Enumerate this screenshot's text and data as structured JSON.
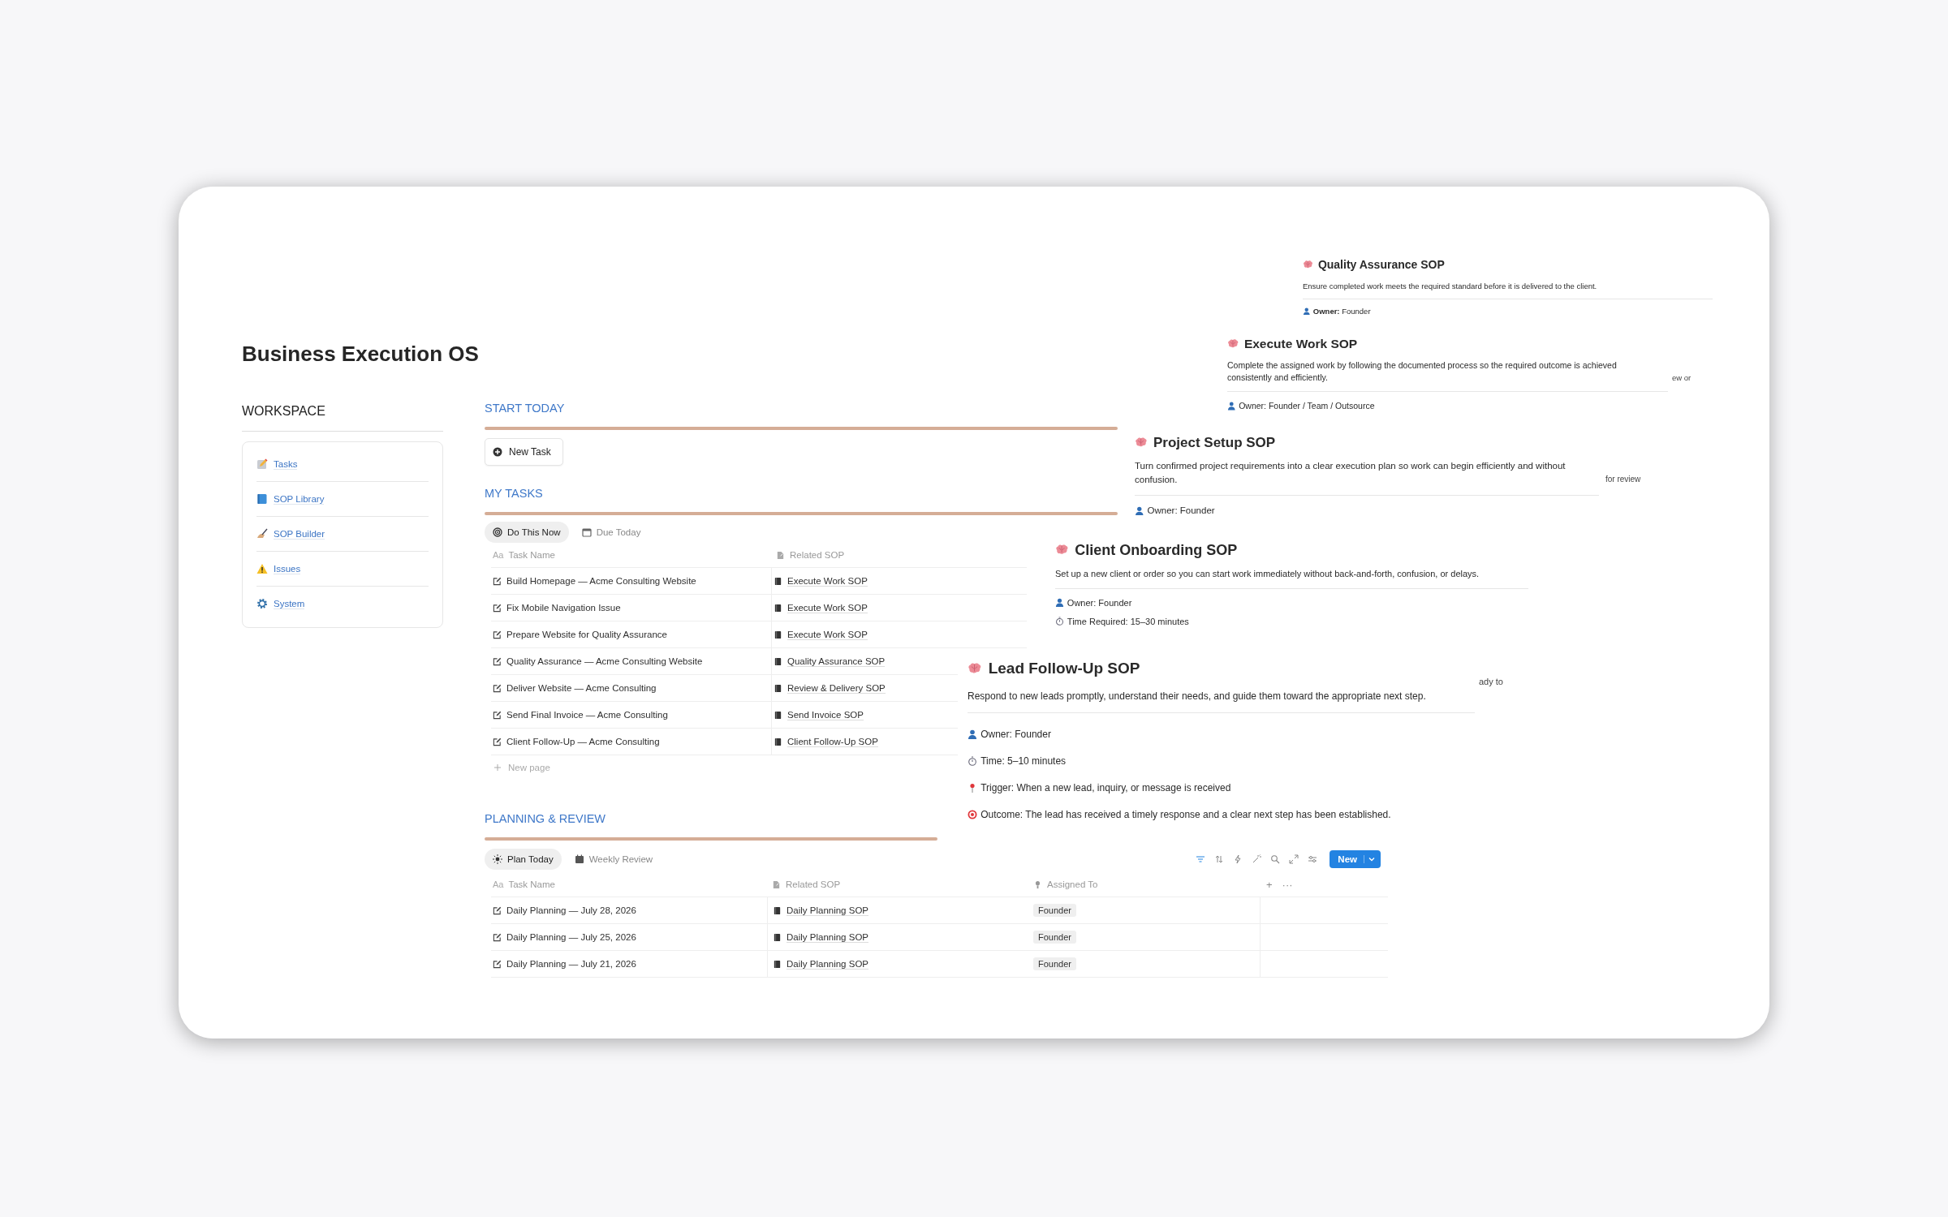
{
  "title": "Business Execution OS",
  "workspace": {
    "heading": "WORKSPACE",
    "items": [
      {
        "label": "Tasks"
      },
      {
        "label": "SOP Library"
      },
      {
        "label": "SOP Builder"
      },
      {
        "label": "Issues"
      },
      {
        "label": "System"
      }
    ]
  },
  "start_today": {
    "heading": "START TODAY",
    "button": "New Task"
  },
  "my_tasks": {
    "heading": "MY TASKS",
    "tabs": [
      {
        "label": "Do This Now",
        "selected": true
      },
      {
        "label": "Due Today",
        "selected": false
      }
    ],
    "name_glyph": "Aa",
    "columns": [
      "Task Name",
      "Related SOP"
    ],
    "rows": [
      {
        "task": "Build Homepage — Acme Consulting Website",
        "sop": "Execute Work SOP"
      },
      {
        "task": "Fix Mobile Navigation Issue",
        "sop": "Execute Work SOP"
      },
      {
        "task": "Prepare Website for Quality Assurance",
        "sop": "Execute Work SOP"
      },
      {
        "task": "Quality Assurance — Acme Consulting Website",
        "sop": "Quality Assurance SOP"
      },
      {
        "task": "Deliver Website — Acme Consulting",
        "sop": "Review & Delivery SOP"
      },
      {
        "task": "Send Final Invoice — Acme Consulting",
        "sop": "Send Invoice SOP"
      },
      {
        "task": "Client Follow-Up — Acme Consulting",
        "sop": "Client Follow-Up SOP"
      }
    ],
    "new_row": "New page"
  },
  "planning": {
    "heading": "PLANNING & REVIEW",
    "tabs": [
      {
        "label": "Plan Today",
        "selected": true
      },
      {
        "label": "Weekly Review",
        "selected": false
      }
    ],
    "new_button": "New",
    "name_glyph": "Aa",
    "columns": [
      "Task Name",
      "Related SOP",
      "Assigned To"
    ],
    "header_actions": [
      "+",
      "···"
    ],
    "rows": [
      {
        "task": "Daily Planning — July 28, 2026",
        "sop": "Daily Planning SOP",
        "assignee": "Founder"
      },
      {
        "task": "Daily Planning — July 25, 2026",
        "sop": "Daily Planning SOP",
        "assignee": "Founder"
      },
      {
        "task": "Daily Planning — July 21, 2026",
        "sop": "Daily Planning SOP",
        "assignee": "Founder"
      }
    ]
  },
  "fragments": [
    "ew or",
    "for review",
    "ady to"
  ],
  "sop_cards": [
    {
      "title": "Quality Assurance SOP",
      "description": "Ensure completed work meets the required standard before it is delivered to the client.",
      "details": [
        {
          "kind": "owner",
          "text": "**Owner:** Founder"
        }
      ]
    },
    {
      "title": "Execute Work SOP",
      "description": "Complete the assigned work by following the documented process so the required outcome is achieved consistently and efficiently.",
      "details": [
        {
          "kind": "owner",
          "text": "Owner: Founder / Team / Outsource"
        }
      ]
    },
    {
      "title": "Project Setup SOP",
      "description": "Turn confirmed project requirements into a clear execution plan so work can begin efficiently and without confusion.",
      "details": [
        {
          "kind": "owner",
          "text": "Owner: Founder"
        }
      ]
    },
    {
      "title": "Client Onboarding SOP",
      "description": "Set up a new client or order so you can start work immediately without back-and-forth, confusion, or delays.",
      "details": [
        {
          "kind": "owner",
          "text": "Owner: Founder"
        },
        {
          "kind": "time",
          "text": "Time Required: 15–30 minutes"
        }
      ]
    },
    {
      "title": "Lead Follow-Up SOP",
      "description": "Respond to new leads promptly, understand their needs, and guide them toward the appropriate next step.",
      "details": [
        {
          "kind": "owner",
          "text": "Owner: Founder"
        },
        {
          "kind": "time",
          "text": "Time: 5–10 minutes"
        },
        {
          "kind": "trigger",
          "text": "Trigger: When a new lead, inquiry, or message is received"
        },
        {
          "kind": "outcome",
          "text": "Outcome: The lead has received a timely response and a clear next step has been established."
        }
      ]
    }
  ]
}
